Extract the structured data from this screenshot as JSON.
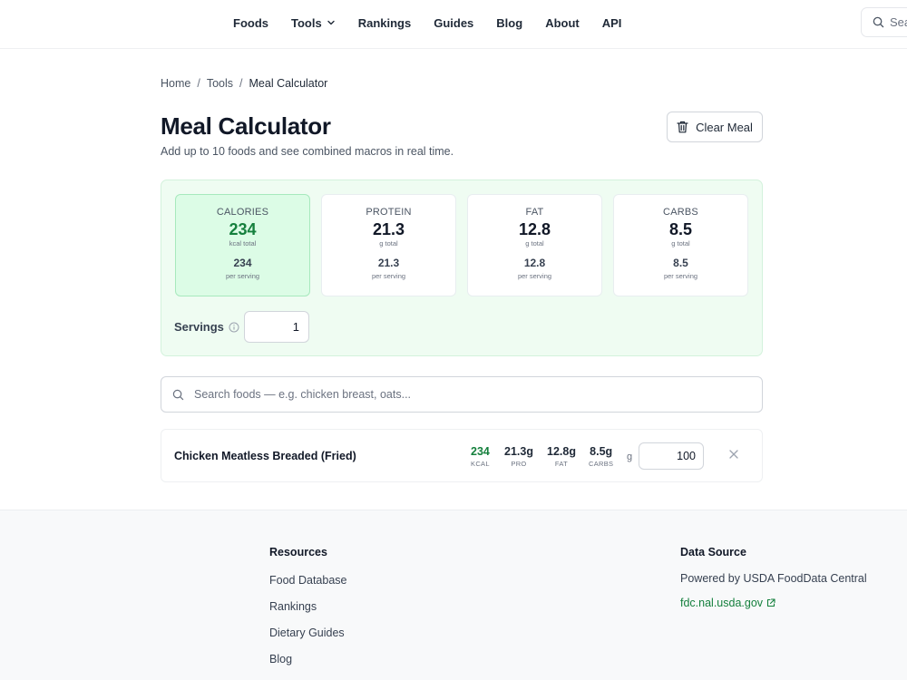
{
  "nav": {
    "items": [
      {
        "label": "Foods"
      },
      {
        "label": "Tools"
      },
      {
        "label": "Rankings"
      },
      {
        "label": "Guides"
      },
      {
        "label": "Blog"
      },
      {
        "label": "About"
      },
      {
        "label": "API"
      }
    ],
    "search_placeholder": "Sea"
  },
  "breadcrumb": {
    "items": [
      "Home",
      "Tools",
      "Meal Calculator"
    ],
    "separator": "/"
  },
  "page": {
    "title": "Meal Calculator",
    "subtitle": "Add up to 10 foods and see combined macros in real time.",
    "clear_label": "Clear Meal"
  },
  "summary": {
    "macros": [
      {
        "label": "CALORIES",
        "value": "234",
        "unit": "kcal total",
        "per": "234",
        "per_label": "per serving"
      },
      {
        "label": "PROTEIN",
        "value": "21.3",
        "unit": "g total",
        "per": "21.3",
        "per_label": "per serving"
      },
      {
        "label": "FAT",
        "value": "12.8",
        "unit": "g total",
        "per": "12.8",
        "per_label": "per serving"
      },
      {
        "label": "CARBS",
        "value": "8.5",
        "unit": "g total",
        "per": "8.5",
        "per_label": "per serving"
      }
    ],
    "servings_label": "Servings",
    "servings_value": "1"
  },
  "food_search": {
    "placeholder": "Search foods — e.g. chicken breast, oats..."
  },
  "foods": [
    {
      "name": "Chicken Meatless Breaded (Fried)",
      "kcal": "234",
      "kcal_label": "KCAL",
      "pro": "21.3g",
      "pro_label": "PRO",
      "fat": "12.8g",
      "fat_label": "FAT",
      "carbs": "8.5g",
      "carbs_label": "CARBS",
      "unit": "g",
      "amount": "100"
    }
  ],
  "footer": {
    "resources_title": "Resources",
    "resources": [
      "Food Database",
      "Rankings",
      "Dietary Guides",
      "Blog"
    ],
    "source_title": "Data Source",
    "source_text": "Powered by USDA FoodData Central",
    "source_link": "fdc.nal.usda.gov"
  },
  "colors": {
    "accent_green": "#15803d",
    "panel_bg": "#effcf2",
    "calorie_card_bg": "#dcfce6"
  }
}
